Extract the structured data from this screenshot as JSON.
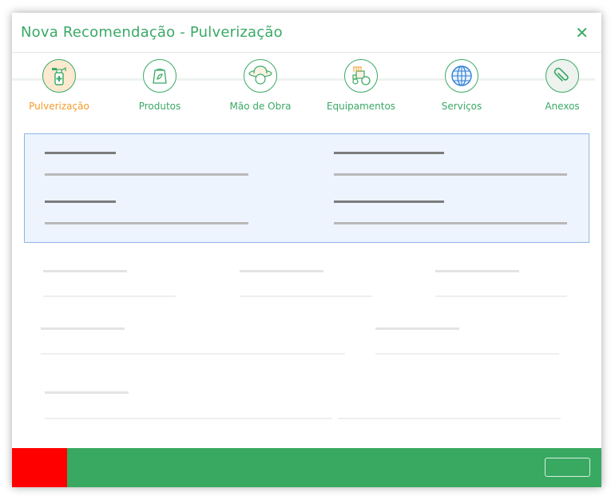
{
  "modal": {
    "title": "Nova Recomendação - Pulverização",
    "close_glyph": "✕"
  },
  "steps": [
    {
      "label": "Pulverização",
      "icon": "sprayer-icon",
      "active": true
    },
    {
      "label": "Produtos",
      "icon": "seed-bag-icon",
      "active": false
    },
    {
      "label": "Mão de Obra",
      "icon": "worker-hat-icon",
      "active": false
    },
    {
      "label": "Equipamentos",
      "icon": "tractor-icon",
      "active": false
    },
    {
      "label": "Serviços",
      "icon": "globe-icon",
      "active": false
    },
    {
      "label": "Anexos",
      "icon": "paperclip-icon",
      "active": false
    }
  ],
  "colors": {
    "accent": "#3aa965",
    "active_step": "#f39c2b",
    "footer": "#39a962",
    "danger": "#ff0000",
    "panel_bg": "#edf4fe",
    "panel_border": "#8db6e8"
  }
}
